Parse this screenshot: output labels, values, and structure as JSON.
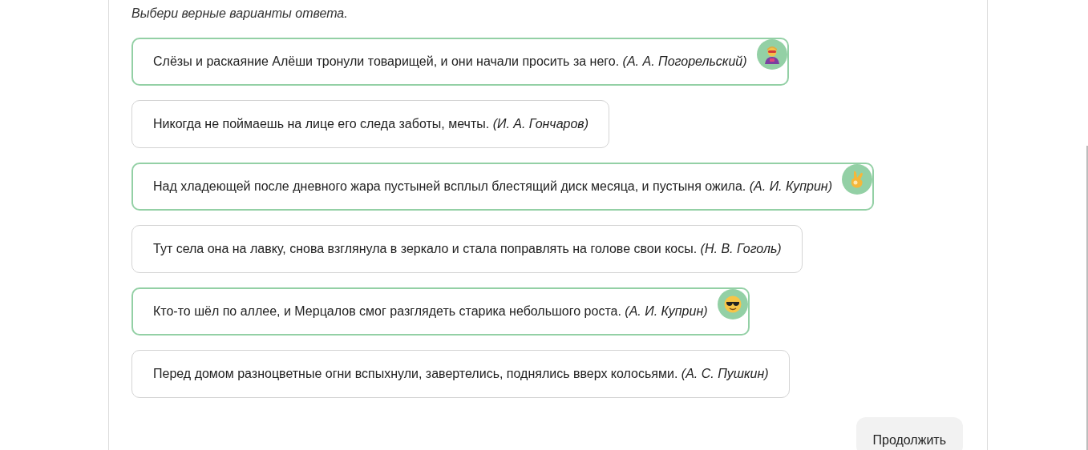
{
  "instruction": "Выбери верные варианты ответа.",
  "options": [
    {
      "text": "Слёзы и раскаяние Алёши тронули товарищей, и они начали просить за него.",
      "author": "(А. А. Погорельский)",
      "selected": true,
      "kind": "hero"
    },
    {
      "text": "Никогда не поймаешь на лице его следа заботы, мечты.",
      "author": "(И. А. Гончаров)",
      "selected": false
    },
    {
      "text": "Над хладеющей после дневного жара пустыней всплыл блестящий диск месяца, и пустыня ожила.",
      "author": "(А. И. Куприн)",
      "selected": true,
      "kind": "ok"
    },
    {
      "text": "Тут села она на лавку, снова взглянула в зеркало и стала поправлять на голове свои косы.",
      "author": "(Н. В. Гоголь)",
      "selected": false
    },
    {
      "text": "Кто-то шёл по аллее, и Мерцалов смог разглядеть старика небольшого роста.",
      "author": "(А. И. Куприн)",
      "selected": true,
      "kind": "cool"
    },
    {
      "text": "Перед домом разноцветные огни вспыхнули, завертелись, поднялись вверх колосьями.",
      "author": "(А. С. Пушкин)",
      "selected": false
    }
  ],
  "continue_button": "Продолжить"
}
